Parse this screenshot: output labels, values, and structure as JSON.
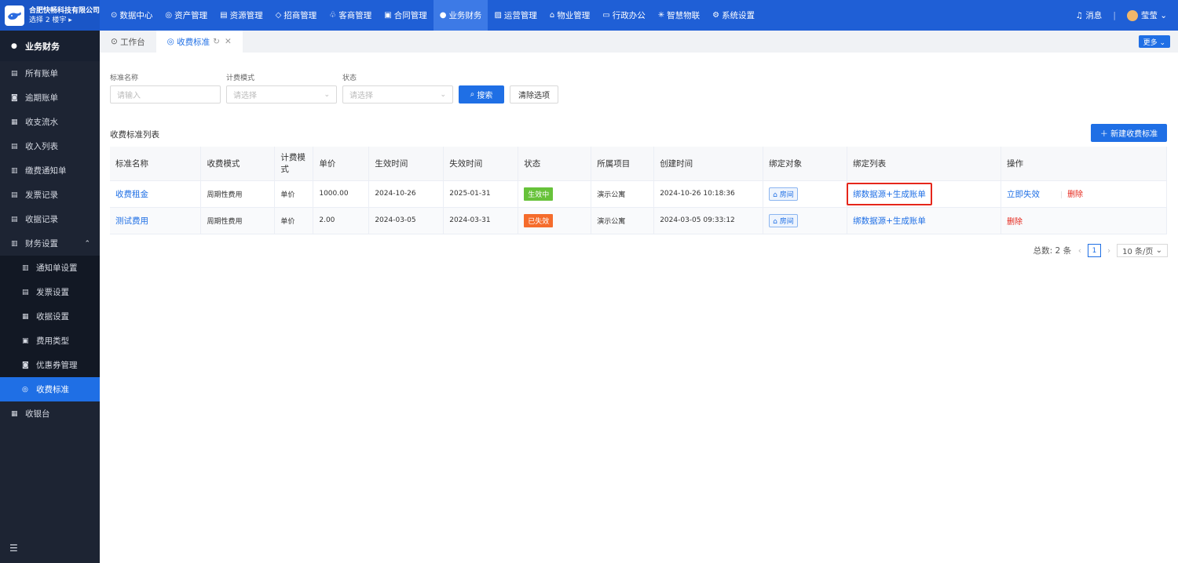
{
  "brand": {
    "company": "合肥快畅科技有限公司",
    "floor_selector": "选择 2 楼宇 ▸"
  },
  "topnav": [
    {
      "label": "数据中心",
      "icon": "⊙"
    },
    {
      "label": "资产管理",
      "icon": "◎"
    },
    {
      "label": "资源管理",
      "icon": "▤"
    },
    {
      "label": "招商管理",
      "icon": "◇"
    },
    {
      "label": "客商管理",
      "icon": "♧"
    },
    {
      "label": "合同管理",
      "icon": "▣"
    },
    {
      "label": "业务财务",
      "icon": "●",
      "active": true
    },
    {
      "label": "运营管理",
      "icon": "▨"
    },
    {
      "label": "物业管理",
      "icon": "⌂"
    },
    {
      "label": "行政办公",
      "icon": "▭"
    },
    {
      "label": "智慧物联",
      "icon": "✳"
    },
    {
      "label": "系统设置",
      "icon": "⚙"
    }
  ],
  "topright": {
    "messages": "消息",
    "user": "莹莹"
  },
  "sidebar": {
    "title": "业务财务",
    "items": [
      {
        "label": "所有账单",
        "icon": "▤"
      },
      {
        "label": "逾期账单",
        "icon": "◙"
      },
      {
        "label": "收支流水",
        "icon": "▦"
      },
      {
        "label": "收入列表",
        "icon": "▤"
      },
      {
        "label": "缴费通知单",
        "icon": "▥"
      },
      {
        "label": "发票记录",
        "icon": "▤"
      },
      {
        "label": "收据记录",
        "icon": "▤"
      },
      {
        "label": "财务设置",
        "icon": "▥",
        "caret": "⌃"
      }
    ],
    "subitems": [
      {
        "label": "通知单设置",
        "icon": "▥"
      },
      {
        "label": "发票设置",
        "icon": "▤"
      },
      {
        "label": "收据设置",
        "icon": "▦"
      },
      {
        "label": "费用类型",
        "icon": "▣"
      },
      {
        "label": "优惠券管理",
        "icon": "◙"
      },
      {
        "label": "收费标准",
        "icon": "◎",
        "active": true
      }
    ],
    "last_item": {
      "label": "收银台",
      "icon": "▦"
    },
    "toggle": "☰"
  },
  "tabs": [
    {
      "label": "工作台",
      "icon": "⊙"
    },
    {
      "label": "收费标准",
      "icon": "◎",
      "active": true
    }
  ],
  "more_label": "更多 ⌄",
  "filters": {
    "name_label": "标准名称",
    "name_placeholder": "请输入",
    "mode_label": "计费模式",
    "mode_placeholder": "请选择",
    "status_label": "状态",
    "status_placeholder": "请选择",
    "search_label": "搜索",
    "clear_label": "清除选项"
  },
  "list": {
    "title": "收费标准列表",
    "new_button": "新建收费标准",
    "columns": [
      "标准名称",
      "收费模式",
      "计费模式",
      "单价",
      "生效时间",
      "失效时间",
      "状态",
      "所属项目",
      "创建时间",
      "绑定对象",
      "绑定列表",
      "操作"
    ],
    "rows": [
      {
        "name": "收费租金",
        "charge_mode": "周期性费用",
        "billing_mode": "单价",
        "price": "1000.00",
        "effective": "2024-10-26",
        "expire": "2025-01-31",
        "status": "生效中",
        "status_color": "#67c23a",
        "project": "演示公寓",
        "created": "2024-10-26 10:18:36",
        "bind_object": "房间",
        "bind_list": "绑数据源+生成账单",
        "action_primary": "立即失效",
        "action_delete": "删除"
      },
      {
        "name": "测试费用",
        "charge_mode": "周期性费用",
        "billing_mode": "单价",
        "price": "2.00",
        "effective": "2024-03-05",
        "expire": "2024-03-31",
        "status": "已失效",
        "status_color": "#f56c2c",
        "project": "演示公寓",
        "created": "2024-03-05 09:33:12",
        "bind_object": "房间",
        "bind_list": "绑数据源+生成账单",
        "action_primary": "",
        "action_delete": "删除"
      }
    ]
  },
  "pagination": {
    "total": "总数: 2 条",
    "current_page": "1",
    "page_size": "10 条/页"
  },
  "colors": {
    "primary": "#1f6fe5",
    "topbar": "#1f5fd6",
    "sidebar": "#1d2433",
    "danger": "#e5261b"
  }
}
